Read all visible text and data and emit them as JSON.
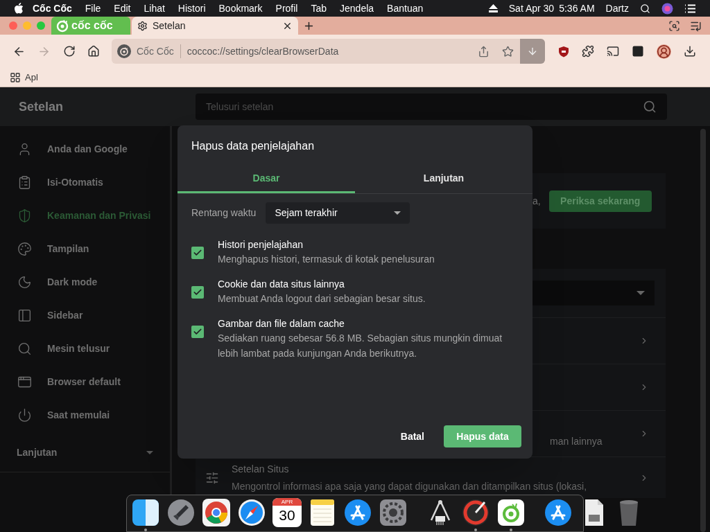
{
  "menu_bar": {
    "app": "Cốc Cốc",
    "items": [
      "File",
      "Edit",
      "Lihat",
      "Histori",
      "Bookmark",
      "Profil",
      "Tab",
      "Jendela",
      "Bantuan"
    ],
    "date": "Sat Apr 30",
    "time": "5:36 AM",
    "user": "Dartz"
  },
  "tab_strip": {
    "logo_text": "cốc cốc",
    "tabs": [
      {
        "title": "Setelan",
        "selected": true
      }
    ]
  },
  "toolbar": {
    "forward": {
      "disabled": true
    },
    "site_label": "Cốc Cốc",
    "url": "coccoc://settings/clearBrowserData"
  },
  "bookmarks": [
    {
      "label": "Apl"
    }
  ],
  "settings": {
    "title": "Setelan",
    "search_placeholder": "Telusuri setelan",
    "sidebar": [
      {
        "label": "Anda dan Google",
        "selected": false
      },
      {
        "label": "Isi-Otomatis",
        "selected": false
      },
      {
        "label": "Keamanan dan Privasi",
        "selected": true
      },
      {
        "label": "Tampilan",
        "selected": false
      },
      {
        "label": "Dark mode",
        "selected": false
      },
      {
        "label": "Sidebar",
        "selected": false
      },
      {
        "label": "Mesin telusur",
        "selected": false
      },
      {
        "label": "Browser default",
        "selected": false
      },
      {
        "label": "Saat memulai",
        "selected": false
      }
    ],
    "advanced": "Lanjutan",
    "background": {
      "fragment_1": "a,",
      "check_button": "Periksa sekarang",
      "fragment_2": "man lainnya",
      "site_settings_title": "Setelan Situs",
      "site_settings_desc": "Mengontrol informasi apa saja yang dapat digunakan dan ditampilkan situs (lokasi,"
    }
  },
  "dialog": {
    "title": "Hapus data penjelajahan",
    "tabs": [
      {
        "label": "Dasar",
        "selected": true
      },
      {
        "label": "Lanjutan",
        "selected": false
      }
    ],
    "time_range_label": "Rentang waktu",
    "time_range_value": "Sejam terakhir",
    "options": [
      {
        "title": "Histori penjelajahan",
        "description": "Menghapus histori, termasuk di kotak penelusuran",
        "checked": true
      },
      {
        "title": "Cookie dan data situs lainnya",
        "description": "Membuat Anda logout dari sebagian besar situs.",
        "checked": true
      },
      {
        "title": "Gambar dan file dalam cache",
        "description": "Sediakan ruang sebesar 56.8 MB. Sebagian situs mungkin dimuat lebih lambat pada kunjungan Anda berikutnya.",
        "checked": true
      }
    ],
    "cancel": "Batal",
    "confirm": "Hapus data"
  },
  "dock": {
    "apps": [
      {
        "kind": "finder",
        "running": true
      },
      {
        "kind": "launchpad",
        "running": false
      },
      {
        "kind": "chrome",
        "running": false
      },
      {
        "kind": "safari",
        "running": false
      },
      {
        "kind": "calendar",
        "running": false,
        "month": "APR",
        "day": "30"
      },
      {
        "kind": "notes",
        "running": false
      },
      {
        "kind": "appstore",
        "running": false
      },
      {
        "kind": "prefs",
        "running": false
      },
      {
        "kind": "separator"
      },
      {
        "kind": "caliper",
        "running": false
      },
      {
        "kind": "gauge",
        "running": true
      },
      {
        "kind": "coccoc",
        "running": true
      },
      {
        "kind": "separator"
      },
      {
        "kind": "appstore",
        "running": false
      },
      {
        "kind": "document",
        "running": false
      },
      {
        "kind": "trash",
        "running": false
      }
    ]
  }
}
